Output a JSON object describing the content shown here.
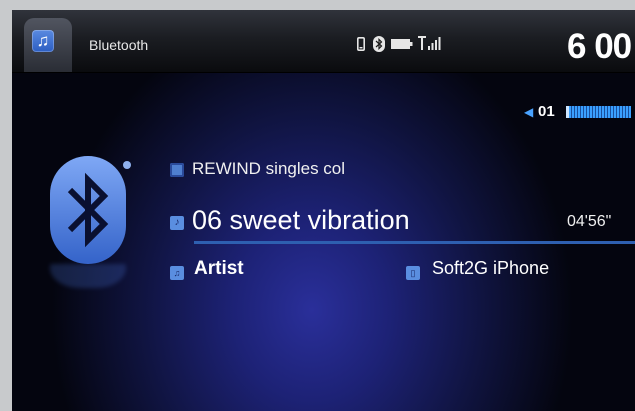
{
  "header": {
    "source_title": "Bluetooth",
    "clock": "6 00",
    "tab_icon": "music-note-icon",
    "status_icons": [
      "phone-icon",
      "bluetooth-icon",
      "battery-icon",
      "signal-icon"
    ]
  },
  "volume": {
    "icon": "speaker-icon",
    "value": "01",
    "level": 0.05
  },
  "now_playing": {
    "album": "REWIND singles col",
    "track": "06 sweet vibration",
    "time": "04'56\"",
    "artist": "Artist",
    "device": "Soft2G iPhone",
    "progress": 0
  },
  "colors": {
    "accent": "#3aa0ff",
    "background": "#101441",
    "text": "#ffffff"
  }
}
